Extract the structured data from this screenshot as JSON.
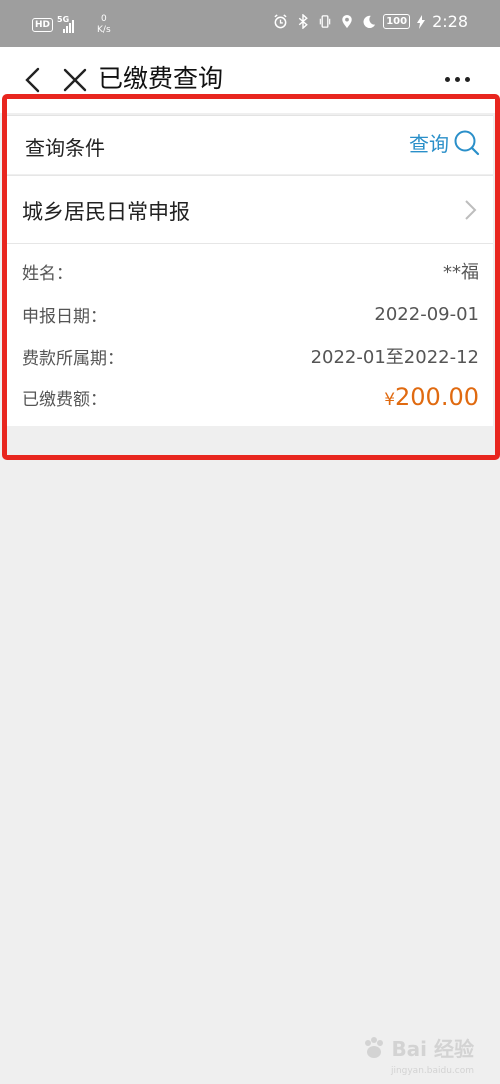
{
  "status_bar": {
    "hd_badge": "HD",
    "network_type": "5G",
    "net_speed_value": "0",
    "net_speed_unit": "K/s",
    "battery": "100",
    "time": "2:28",
    "icons": [
      "alarm-icon",
      "bluetooth-icon",
      "vibrate-icon",
      "location-icon",
      "moon-icon",
      "charging-icon"
    ]
  },
  "nav": {
    "title": "已缴费查询"
  },
  "query": {
    "label": "查询条件",
    "button_label": "查询"
  },
  "record": {
    "title": "城乡居民日常申报",
    "fields": [
      {
        "label": "姓名：",
        "value": "**福"
      },
      {
        "label": "申报日期：",
        "value": "2022-09-01"
      },
      {
        "label": "费款所属期：",
        "value": "2022-01至2022-12"
      }
    ],
    "amount_label": "已缴费额：",
    "amount_currency": "¥",
    "amount_value": "200.00"
  },
  "watermark": {
    "text": "Bai 经验",
    "sub": "jingyan.baidu.com"
  },
  "colors": {
    "accent": "#2a8fc9",
    "amount": "#e06a10",
    "highlight": "#e8261f",
    "status_bar": "#9e9e9e",
    "page_bg": "#efefef"
  }
}
